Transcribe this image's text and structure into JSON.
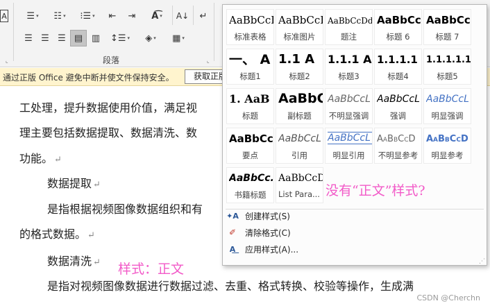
{
  "ribbon": {
    "paragraph_label": "段落",
    "styles_dropdown_glyph": "▾"
  },
  "infobar": {
    "message": "通过正版 Office 避免中断并使文件保持安全。",
    "button_label": "获取正版"
  },
  "document": {
    "lines": [
      "工处理，提升数据使用价值，满足视",
      "理主要包括数据提取、数据清洗、数",
      "功能。",
      "数据提取",
      "是指根据视频图像数据组织和有",
      "的格式数据。",
      "数据清洗",
      "是指对视频图像数据进行数据过滤、去重、格式转换、校验等操作，生成满"
    ],
    "paragraph_mark": "↵"
  },
  "annotations": {
    "style_note": "样式：正文",
    "question_note": "没有“正文”样式?"
  },
  "gallery": {
    "tiles": [
      {
        "preview": "AaBbCcI",
        "name": "标准表格"
      },
      {
        "preview": "AaBbCcI",
        "name": "标准图片"
      },
      {
        "preview": "AaBbCcDd",
        "name": "题注"
      },
      {
        "preview": "AaBbCc",
        "name": "标题 6"
      },
      {
        "preview": "AaBbCcl",
        "name": "标题 7"
      },
      {
        "preview": "一、 A",
        "name": "标题1"
      },
      {
        "preview": "1.1  A",
        "name": "标题2"
      },
      {
        "preview": "1.1.1  A",
        "name": "标题3"
      },
      {
        "preview": "1.1.1.1",
        "name": "标题4"
      },
      {
        "preview": "1.1.1.1.1",
        "name": "标题5"
      },
      {
        "preview": "1.  AaB",
        "name": "标题"
      },
      {
        "preview": "AaBbC",
        "name": "副标题"
      },
      {
        "preview": "AaBbCcL",
        "name": "不明显强调"
      },
      {
        "preview": "AaBbCcL",
        "name": "强调"
      },
      {
        "preview": "AaBbCcL",
        "name": "明显强调"
      },
      {
        "preview": "AaBbCcl",
        "name": "要点"
      },
      {
        "preview": "AaBbCcL",
        "name": "引用"
      },
      {
        "preview": "AaBbCcL",
        "name": "明显引用"
      },
      {
        "preview": "AaBbCcD",
        "name": "不明显参考"
      },
      {
        "preview": "AaBbCcD",
        "name": "明显参考"
      },
      {
        "preview": "AaBbCc.",
        "name": "书籍标题"
      },
      {
        "preview": "AaBbCcD",
        "name": "List Para..."
      }
    ],
    "commands": [
      {
        "label": "创建样式(S)"
      },
      {
        "label": "清除格式(C)"
      },
      {
        "label": "应用样式(A)..."
      }
    ]
  },
  "watermark": "CSDN @Cherchn",
  "colors": {
    "annotation_pink": "#f25ac8",
    "infobar_bg": "#fff4ce",
    "ribbon_bg": "#f3f3f3"
  }
}
